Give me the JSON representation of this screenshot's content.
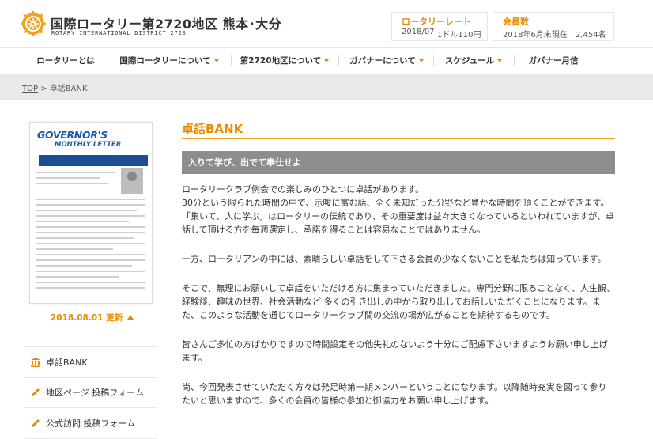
{
  "header": {
    "title": "国際ロータリー第2720地区 熊本･大分",
    "subtitle": "ROTARY INTERNATIONAL DISTRICT 2720",
    "rate": {
      "label": "ロータリーレート",
      "period": "2018/07",
      "value": "1ドル110円"
    },
    "members": {
      "label": "会員数",
      "asof": "2018年6月末現在",
      "value": "2,454名"
    },
    "colors": {
      "accent": "#e88b00",
      "logo": "#f0a31e"
    }
  },
  "nav": {
    "items": [
      {
        "label": "ロータリーとは",
        "caret": false
      },
      {
        "label": "国際ロータリーについて",
        "caret": true
      },
      {
        "label": "第2720地区について",
        "caret": true
      },
      {
        "label": "ガバナーについて",
        "caret": true
      },
      {
        "label": "スケジュール",
        "caret": true
      },
      {
        "label": "ガバナー月信",
        "caret": false
      }
    ]
  },
  "breadcrumb": {
    "home": "TOP",
    "sep": ">",
    "current": "卓話BANK"
  },
  "sidebar": {
    "cover_title": "GOVERNOR'S",
    "cover_subtitle": "MONTHLY LETTER",
    "update_label": "2018.08.01 更新",
    "items": [
      {
        "label": "卓話BANK",
        "icon": "bank-icon"
      },
      {
        "label": "地区ページ 投稿フォーム",
        "icon": "pencil-icon"
      },
      {
        "label": "公式訪問 投稿フォーム",
        "icon": "pencil-icon"
      }
    ]
  },
  "main": {
    "title": "卓話BANK",
    "subheading": "入りて学び、出でて奉仕せよ",
    "paragraphs": [
      "ロータリークラブ例会での楽しみのひとつに卓話があります。\n30分という限られた時間の中で、示唆に富む話、全く未知だった分野など豊かな時間を頂くことができます。\n「集いて、人に学ぶ」はロータリーの伝統であり、その重要度は益々大きくなっているといわれていますが、卓話して頂ける方を毎週選定し、承諾を得ることは容易なことではありません。",
      "一方、ロータリアンの中には、素晴らしい卓話をして下さる会員の少なくないことを私たちは知っています。",
      "そこで、無理にお願いして卓話をいただける方に集まっていただきました。専門分野に限ることなく、人生観、経験談、趣味の世界、社会活動など 多くの引き出しの中から取り出してお話しいただくことになります。また、このような活動を通じてロータリークラブ間の交流の場が広がることを期待するものです。",
      "皆さんご多忙の方ばかりですので時間設定その他失礼のないよう十分にご配慮下さいますようお願い申し上げます。",
      "尚、今回発表させていただく方々は発足時第一期メンバーということになります。以降随時充実を図って参りたいと思いますので、多くの会員の皆様の参加と御協力をお願い申し上げます。"
    ]
  }
}
